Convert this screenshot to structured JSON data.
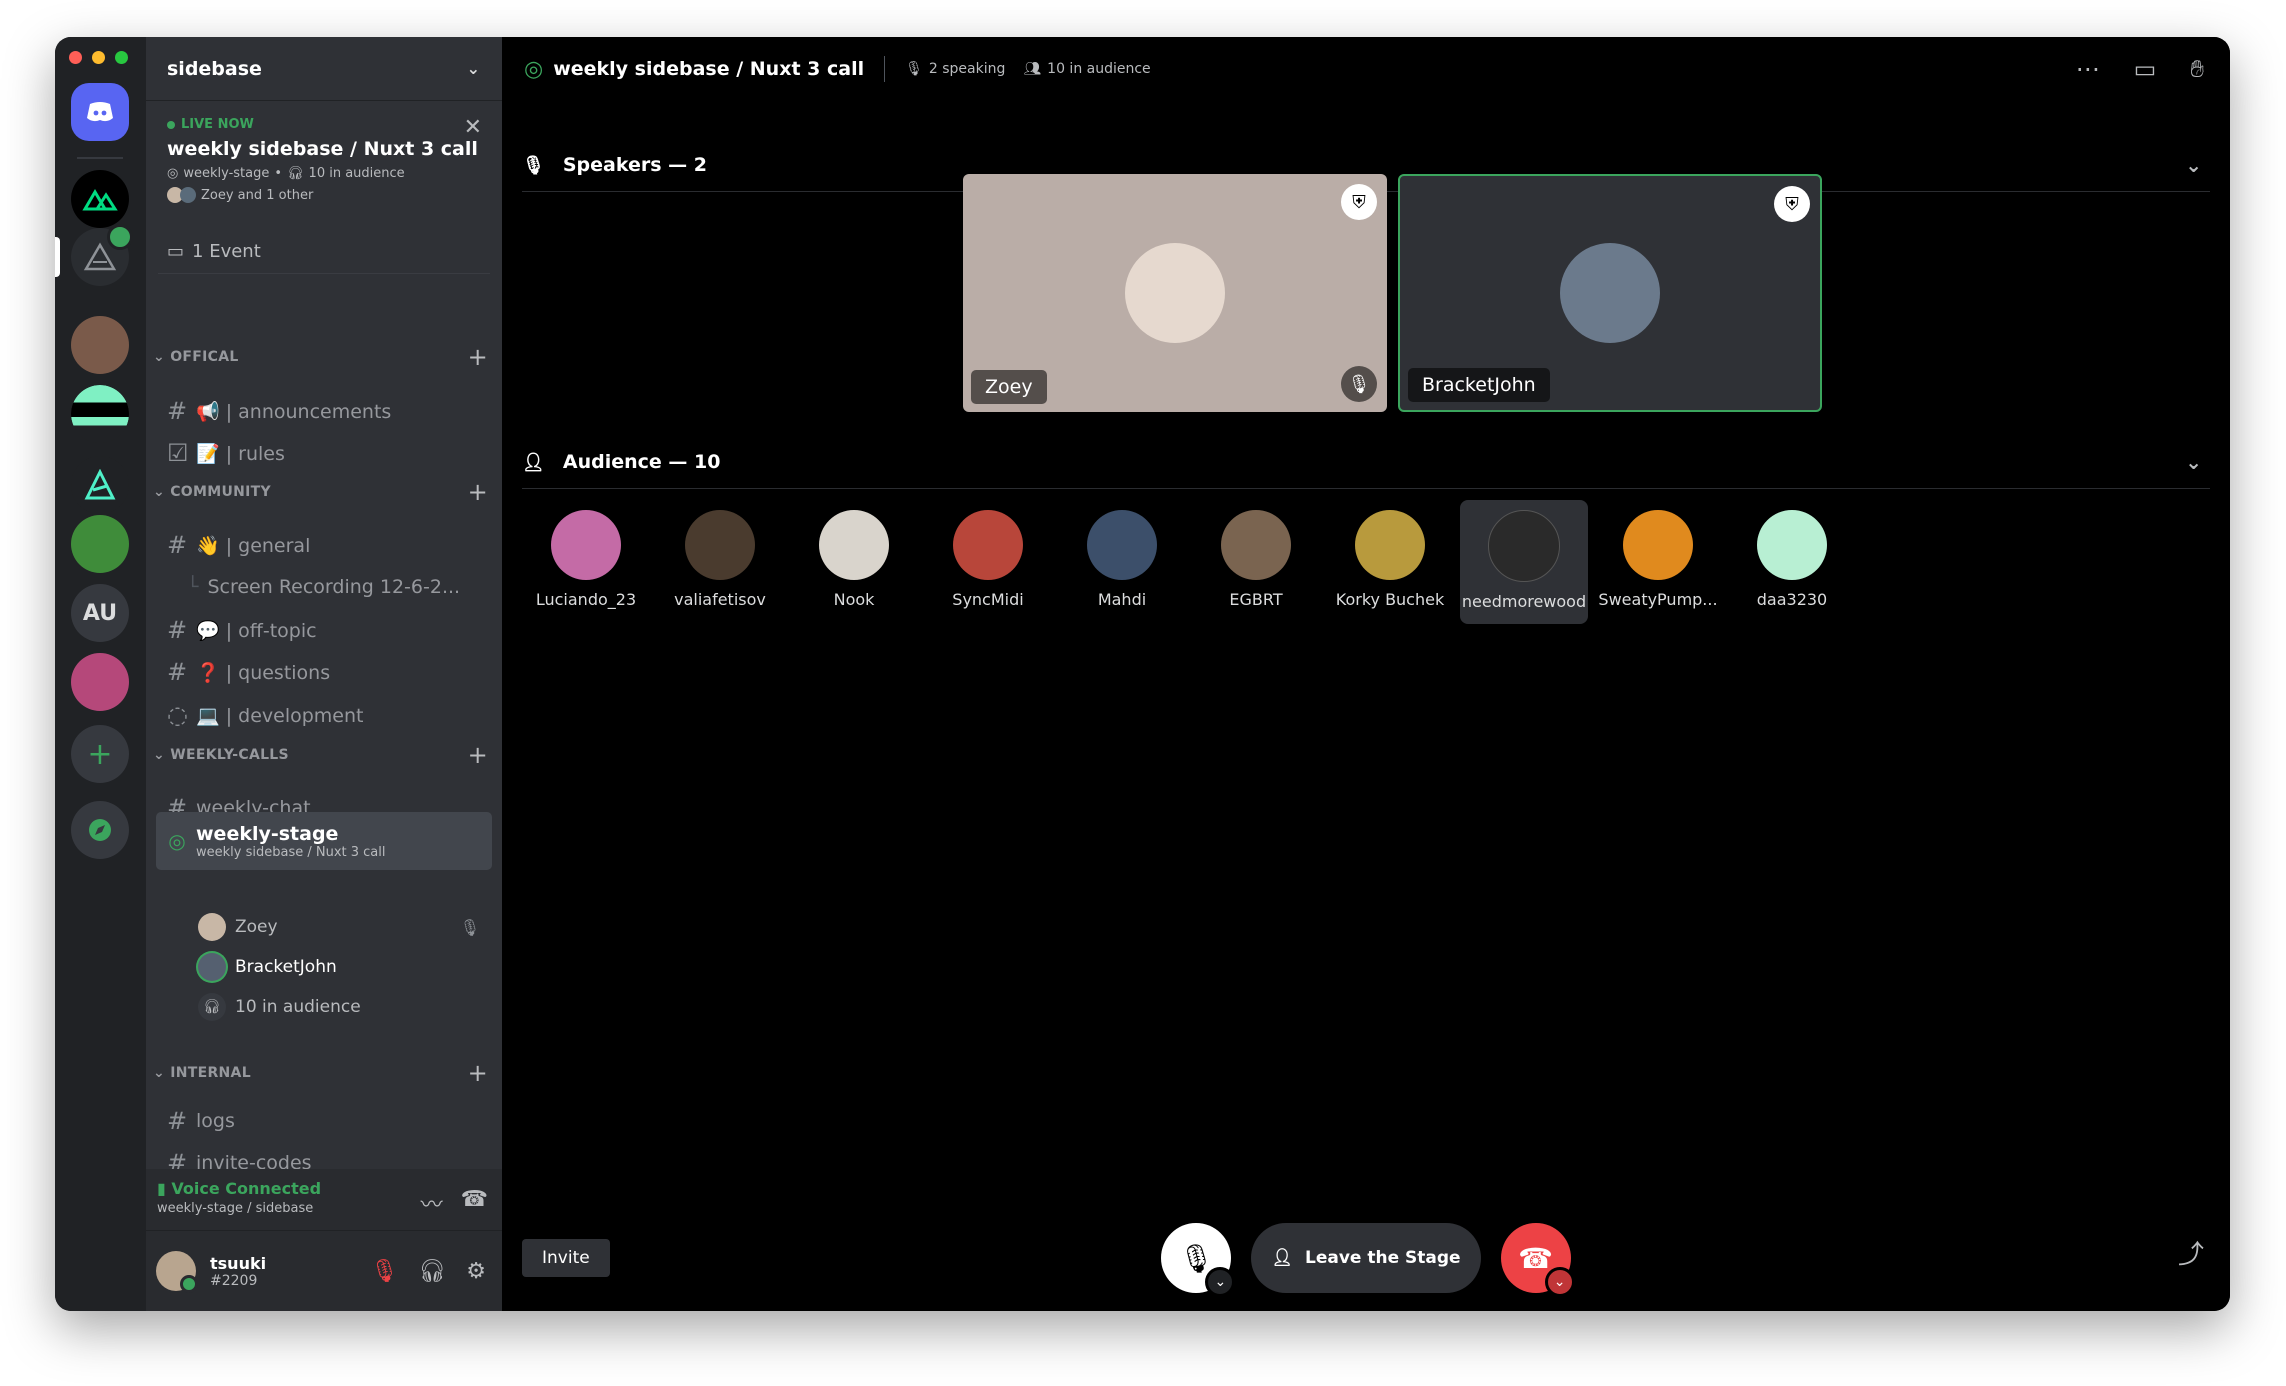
{
  "server": {
    "name": "sidebase"
  },
  "live": {
    "tag": "LIVE NOW",
    "title": "weekly sidebase / Nuxt 3 call",
    "stage": "weekly-stage",
    "audience": "10 in audience",
    "people": "Zoey and 1 other"
  },
  "event": {
    "label": "1 Event"
  },
  "categories": {
    "offical": "OFFICAL",
    "community": "COMMUNITY",
    "weekly_calls": "WEEKLY-CALLS",
    "internal": "INTERNAL"
  },
  "channels": {
    "announcements": "📢 | announcements",
    "rules": "📝 | rules",
    "general": "👋 | general",
    "thread": "Screen Recording 12-6-2...",
    "off_topic": "💬 | off-topic",
    "questions": "❓ | questions",
    "development": "💻 | development",
    "weekly_chat": "weekly-chat",
    "weekly_stage": "weekly-stage",
    "weekly_stage_sub": "weekly sidebase / Nuxt 3 call",
    "stage_user1": "Zoey",
    "stage_user2": "BracketJohn",
    "stage_audience": "10 in audience",
    "logs": "logs",
    "invite_codes": "invite-codes"
  },
  "voice": {
    "status": "Voice Connected",
    "location": "weekly-stage / sidebase"
  },
  "user": {
    "name": "tsuuki",
    "tag": "#2209"
  },
  "topbar": {
    "title": "weekly sidebase / Nuxt 3 call",
    "speaking": "2 speaking",
    "audience": "10 in audience"
  },
  "speakers": {
    "header": "Speakers — 2",
    "list": [
      {
        "name": "Zoey",
        "muted": true
      },
      {
        "name": "BracketJohn",
        "muted": false
      }
    ]
  },
  "audience": {
    "header": "Audience — 10",
    "list": [
      {
        "name": "Luciando_23",
        "color": "#c46ba6"
      },
      {
        "name": "valiafetisov",
        "color": "#4a3b2e"
      },
      {
        "name": "Nook",
        "color": "#d9d4cc"
      },
      {
        "name": "SyncMidi",
        "color": "#b8463a"
      },
      {
        "name": "Mahdi",
        "color": "#3c4f6a"
      },
      {
        "name": "EGBRT",
        "color": "#7a6450"
      },
      {
        "name": "Korky Buchek",
        "color": "#b89a3d"
      },
      {
        "name": "needmorewood",
        "color": "#2a2a2a"
      },
      {
        "name": "SweatyPump...",
        "color": "#e08a1e"
      },
      {
        "name": "daa3230",
        "color": "#b8efd3"
      }
    ]
  },
  "controls": {
    "invite": "Invite",
    "leave": "Leave the Stage"
  },
  "rail": {
    "au_label": "AU"
  },
  "colors": {
    "accent_green": "#3ba55d",
    "danger": "#ed4245",
    "bg": "#000000"
  }
}
